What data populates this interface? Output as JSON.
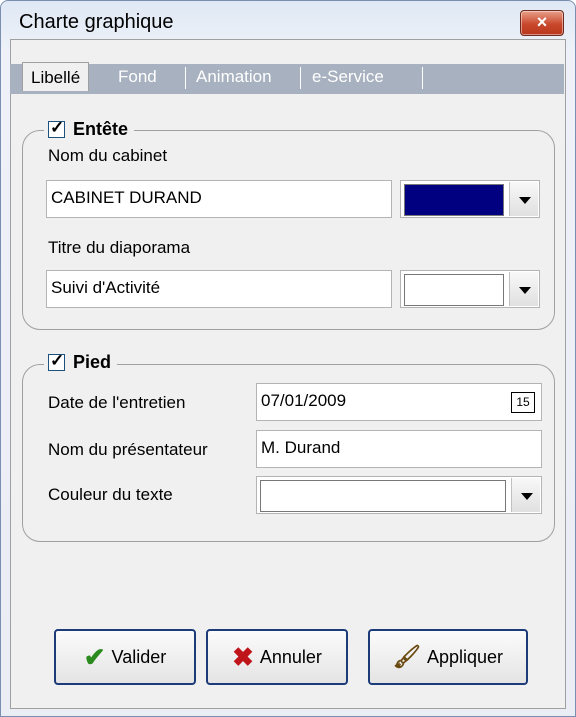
{
  "window": {
    "title": "Charte graphique",
    "close_label": "×"
  },
  "tabs": [
    "Libellé",
    "Fond",
    "Animation",
    "e-Service"
  ],
  "entete": {
    "legend": "Entête",
    "checked": true,
    "nom_label": "Nom du cabinet",
    "nom_value": "CABINET DURAND",
    "nom_color": "#000080",
    "titre_label": "Titre du diaporama",
    "titre_value": "Suivi d'Activité",
    "titre_color": "#ffffff"
  },
  "pied": {
    "legend": "Pied",
    "checked": true,
    "date_label": "Date de l'entretien",
    "date_value": "07/01/2009",
    "calendar_label": "15",
    "presentateur_label": "Nom du présentateur",
    "presentateur_value": "M. Durand",
    "couleur_label": "Couleur du texte",
    "couleur_value": ""
  },
  "buttons": {
    "valider": "Valider",
    "annuler": "Annuler",
    "appliquer": "Appliquer"
  },
  "icons": {
    "valider": "check-icon",
    "annuler": "cross-icon",
    "appliquer": "brush-icon",
    "calendar": "calendar-icon"
  }
}
